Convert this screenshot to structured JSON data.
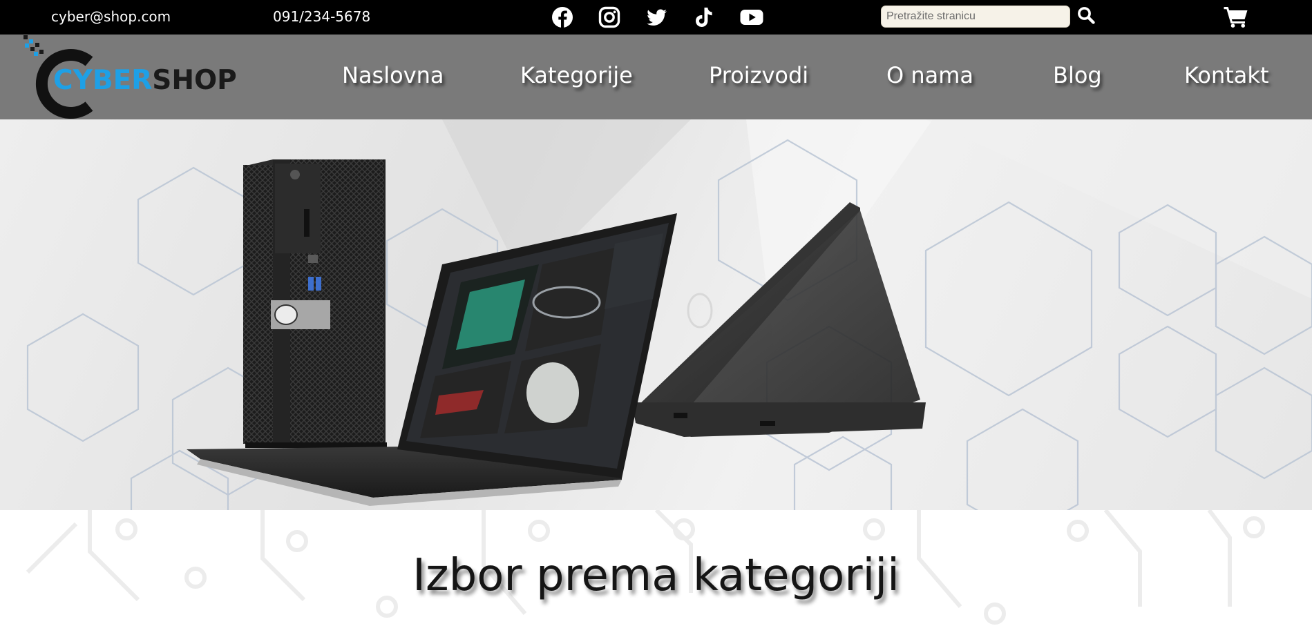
{
  "topbar": {
    "email": "cyber@shop.com",
    "phone": "091/234-5678",
    "socials": [
      {
        "icon": "facebook-icon"
      },
      {
        "icon": "instagram-icon"
      },
      {
        "icon": "twitter-icon"
      },
      {
        "icon": "tiktok-icon"
      },
      {
        "icon": "youtube-icon"
      }
    ],
    "search_placeholder": "Pretražite stranicu",
    "search_value": "",
    "search_icon": "search-icon",
    "cart_icon": "cart-icon"
  },
  "header": {
    "logo": {
      "part1": "CYBER",
      "part2": "SHOP"
    },
    "nav": [
      "Naslovna",
      "Kategorije",
      "Proizvodi",
      "O nama",
      "Blog",
      "Kontakt"
    ]
  },
  "section": {
    "title": "Izbor prema kategoriji"
  },
  "colors": {
    "topbar_bg": "#000000",
    "header_bg": "#7a7a7a",
    "logo_accent": "#1ea0e6",
    "search_bg": "#f6f2e8"
  }
}
